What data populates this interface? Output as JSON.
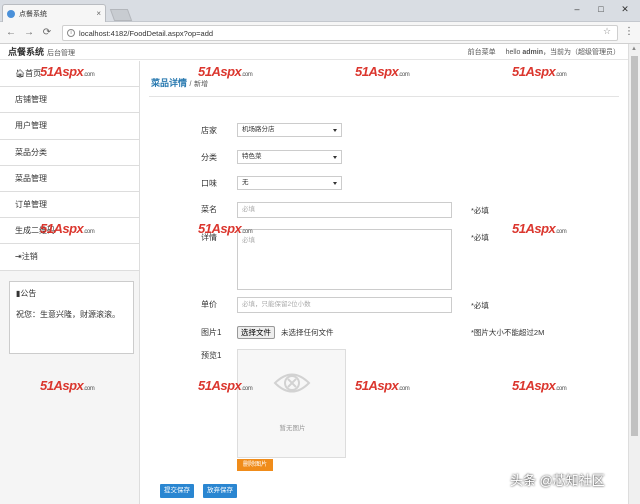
{
  "browser": {
    "tab_title": "点餐系统",
    "url": "localhost:4182/FoodDetail.aspx?op=add"
  },
  "header": {
    "brand": "点餐系统",
    "brand_sub": "后台管理",
    "front_menu": "前台菜单",
    "hello": "hello",
    "user": "admin",
    "role": "，当前为（超级管理员）"
  },
  "sidebar": {
    "items": [
      {
        "label": "首页"
      },
      {
        "label": "店铺管理"
      },
      {
        "label": "用户管理"
      },
      {
        "label": "菜品分类"
      },
      {
        "label": "菜品管理"
      },
      {
        "label": "订单管理"
      },
      {
        "label": "生成二维码"
      },
      {
        "label": "注销"
      }
    ],
    "notice_title": "公告",
    "notice_body": "祝您：生意兴隆，财源滚滚。"
  },
  "main": {
    "breadcrumb_title": "菜品详情",
    "breadcrumb_sub": "新增",
    "fields": {
      "store_label": "店家",
      "store_value": "机场路分店",
      "category_label": "分类",
      "category_value": "特色菜",
      "flavor_label": "口味",
      "flavor_value": "无",
      "name_label": "菜名",
      "name_placeholder": "必填",
      "name_hint": "*必填",
      "detail_label": "详情",
      "detail_placeholder": "必填",
      "detail_hint": "*必填",
      "price_label": "单价",
      "price_placeholder": "必填，只能保留2位小数",
      "price_hint": "*必填",
      "image_label": "图片1",
      "file_button": "选择文件",
      "file_status": "未选择任何文件",
      "image_hint": "*图片大小不能超过2M",
      "preview_label": "预览1",
      "no_image": "暂无图片",
      "delete_image": "删除图片"
    },
    "submit": "提交保存",
    "discard": "放弃保存"
  },
  "watermark": {
    "a": "51",
    "b": "Aspx",
    "c": ".com"
  },
  "credit": "头条 @芯知社区",
  "colors": {
    "accent": "#2a86d1",
    "danger": "#f08c1a",
    "watermark": "#d8261d"
  }
}
